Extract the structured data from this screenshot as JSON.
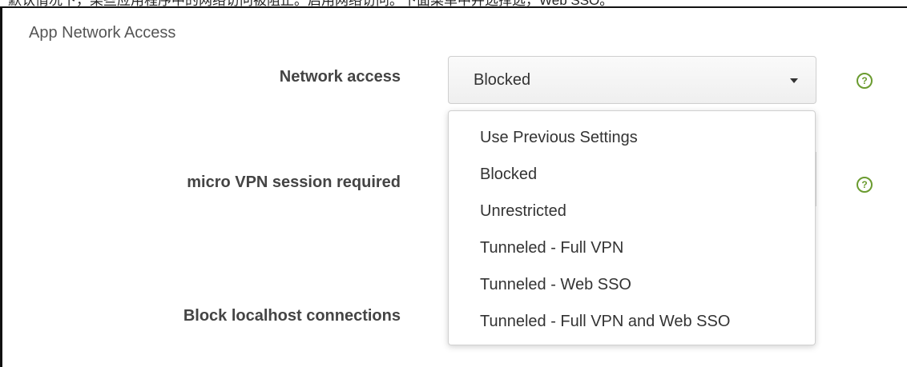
{
  "banner": {
    "partial_text": "默认情况下，某些应用程序中的网络访问被阻止。启用网络访问。下面菜单中并选择选，Web SSO。"
  },
  "section": {
    "title": "App Network Access"
  },
  "fields": {
    "network_access_label": "Network access",
    "micro_vpn_label": "micro VPN session required",
    "block_localhost_label": "Block localhost connections"
  },
  "network_access_select": {
    "selected_value": "Blocked",
    "options": [
      "Use Previous Settings",
      "Blocked",
      "Unrestricted",
      "Tunneled - Full VPN",
      "Tunneled - Web SSO",
      "Tunneled - Full VPN and Web SSO"
    ]
  },
  "help": {
    "glyph": "?"
  },
  "colors": {
    "help_icon": "#6a9b2f",
    "label_text": "#444444"
  }
}
